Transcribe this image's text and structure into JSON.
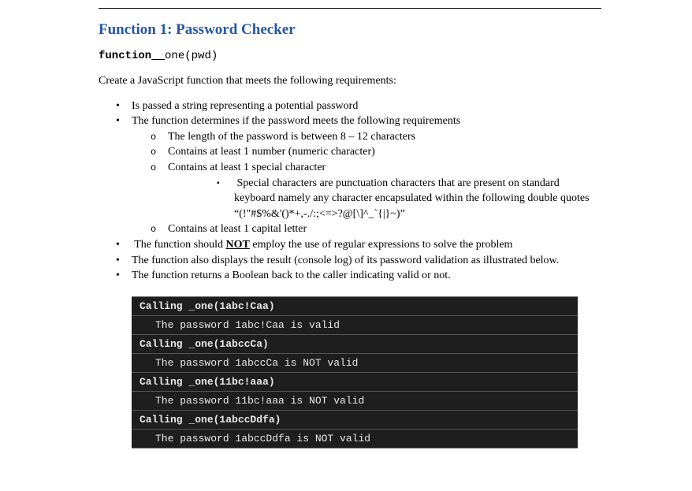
{
  "heading": "Function 1: Password Checker",
  "signature": {
    "keyword": "function",
    "underscore": " _",
    "rest": "one(pwd)"
  },
  "intro": "Create a JavaScript function that meets the following requirements:",
  "bullets": {
    "b1": "Is passed a string representing a potential password",
    "b2": "The function determines if the password meets the following requirements",
    "s1": "The length of the password is between 8 – 12 characters",
    "s2": "Contains at least 1 number (numeric character)",
    "s3": "Contains at least 1 special character",
    "sub1a": "Special characters are punctuation characters that are present on standard keyboard namely any character encapsulated within the following double quotes",
    "sub1b": "“(!\"#$%&'()*+,-./:;<=>?@[\\]^_`{|}~)”",
    "s4": "Contains at least 1 capital letter",
    "b3a": "The function should ",
    "b3not": "NOT",
    "b3b": " employ the use of regular expressions to solve the problem",
    "b4": "The function also displays the result (console log) of its password validation as illustrated below.",
    "b5": "The function returns a Boolean back to the caller indicating valid or not."
  },
  "terminal": {
    "r1": "Calling _one(1abc!Caa)",
    "r2": "The password 1abc!Caa is valid",
    "r3": "Calling _one(1abccCa)",
    "r4": "The password 1abccCa is NOT valid",
    "r5": "Calling _one(11bc!aaa)",
    "r6": "The password 11bc!aaa is NOT valid",
    "r7": "Calling _one(1abccDdfa)",
    "r8": "The password 1abccDdfa is NOT valid"
  }
}
